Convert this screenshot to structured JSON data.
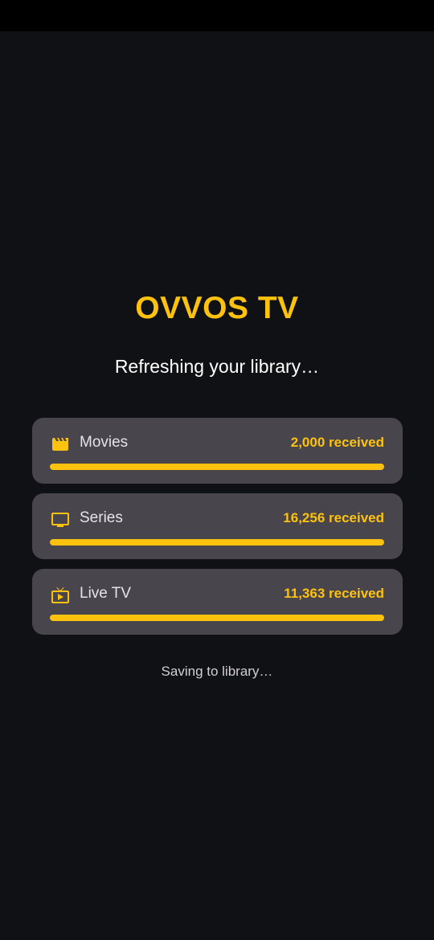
{
  "app": {
    "title": "OVVOS TV",
    "subtitle": "Refreshing your library…"
  },
  "categories": [
    {
      "label": "Movies",
      "count": "2,000 received",
      "progress": 1.0,
      "icon": "clapperboard-icon"
    },
    {
      "label": "Series",
      "count": "16,256 received",
      "progress": 1.0,
      "icon": "tv-monitor-icon"
    },
    {
      "label": "Live TV",
      "count": "11,363 received",
      "progress": 1.0,
      "icon": "live-tv-icon"
    }
  ],
  "status": "Saving to library…",
  "colors": {
    "accent": "#FDC20D",
    "background": "#101114",
    "card": "#48454D"
  }
}
